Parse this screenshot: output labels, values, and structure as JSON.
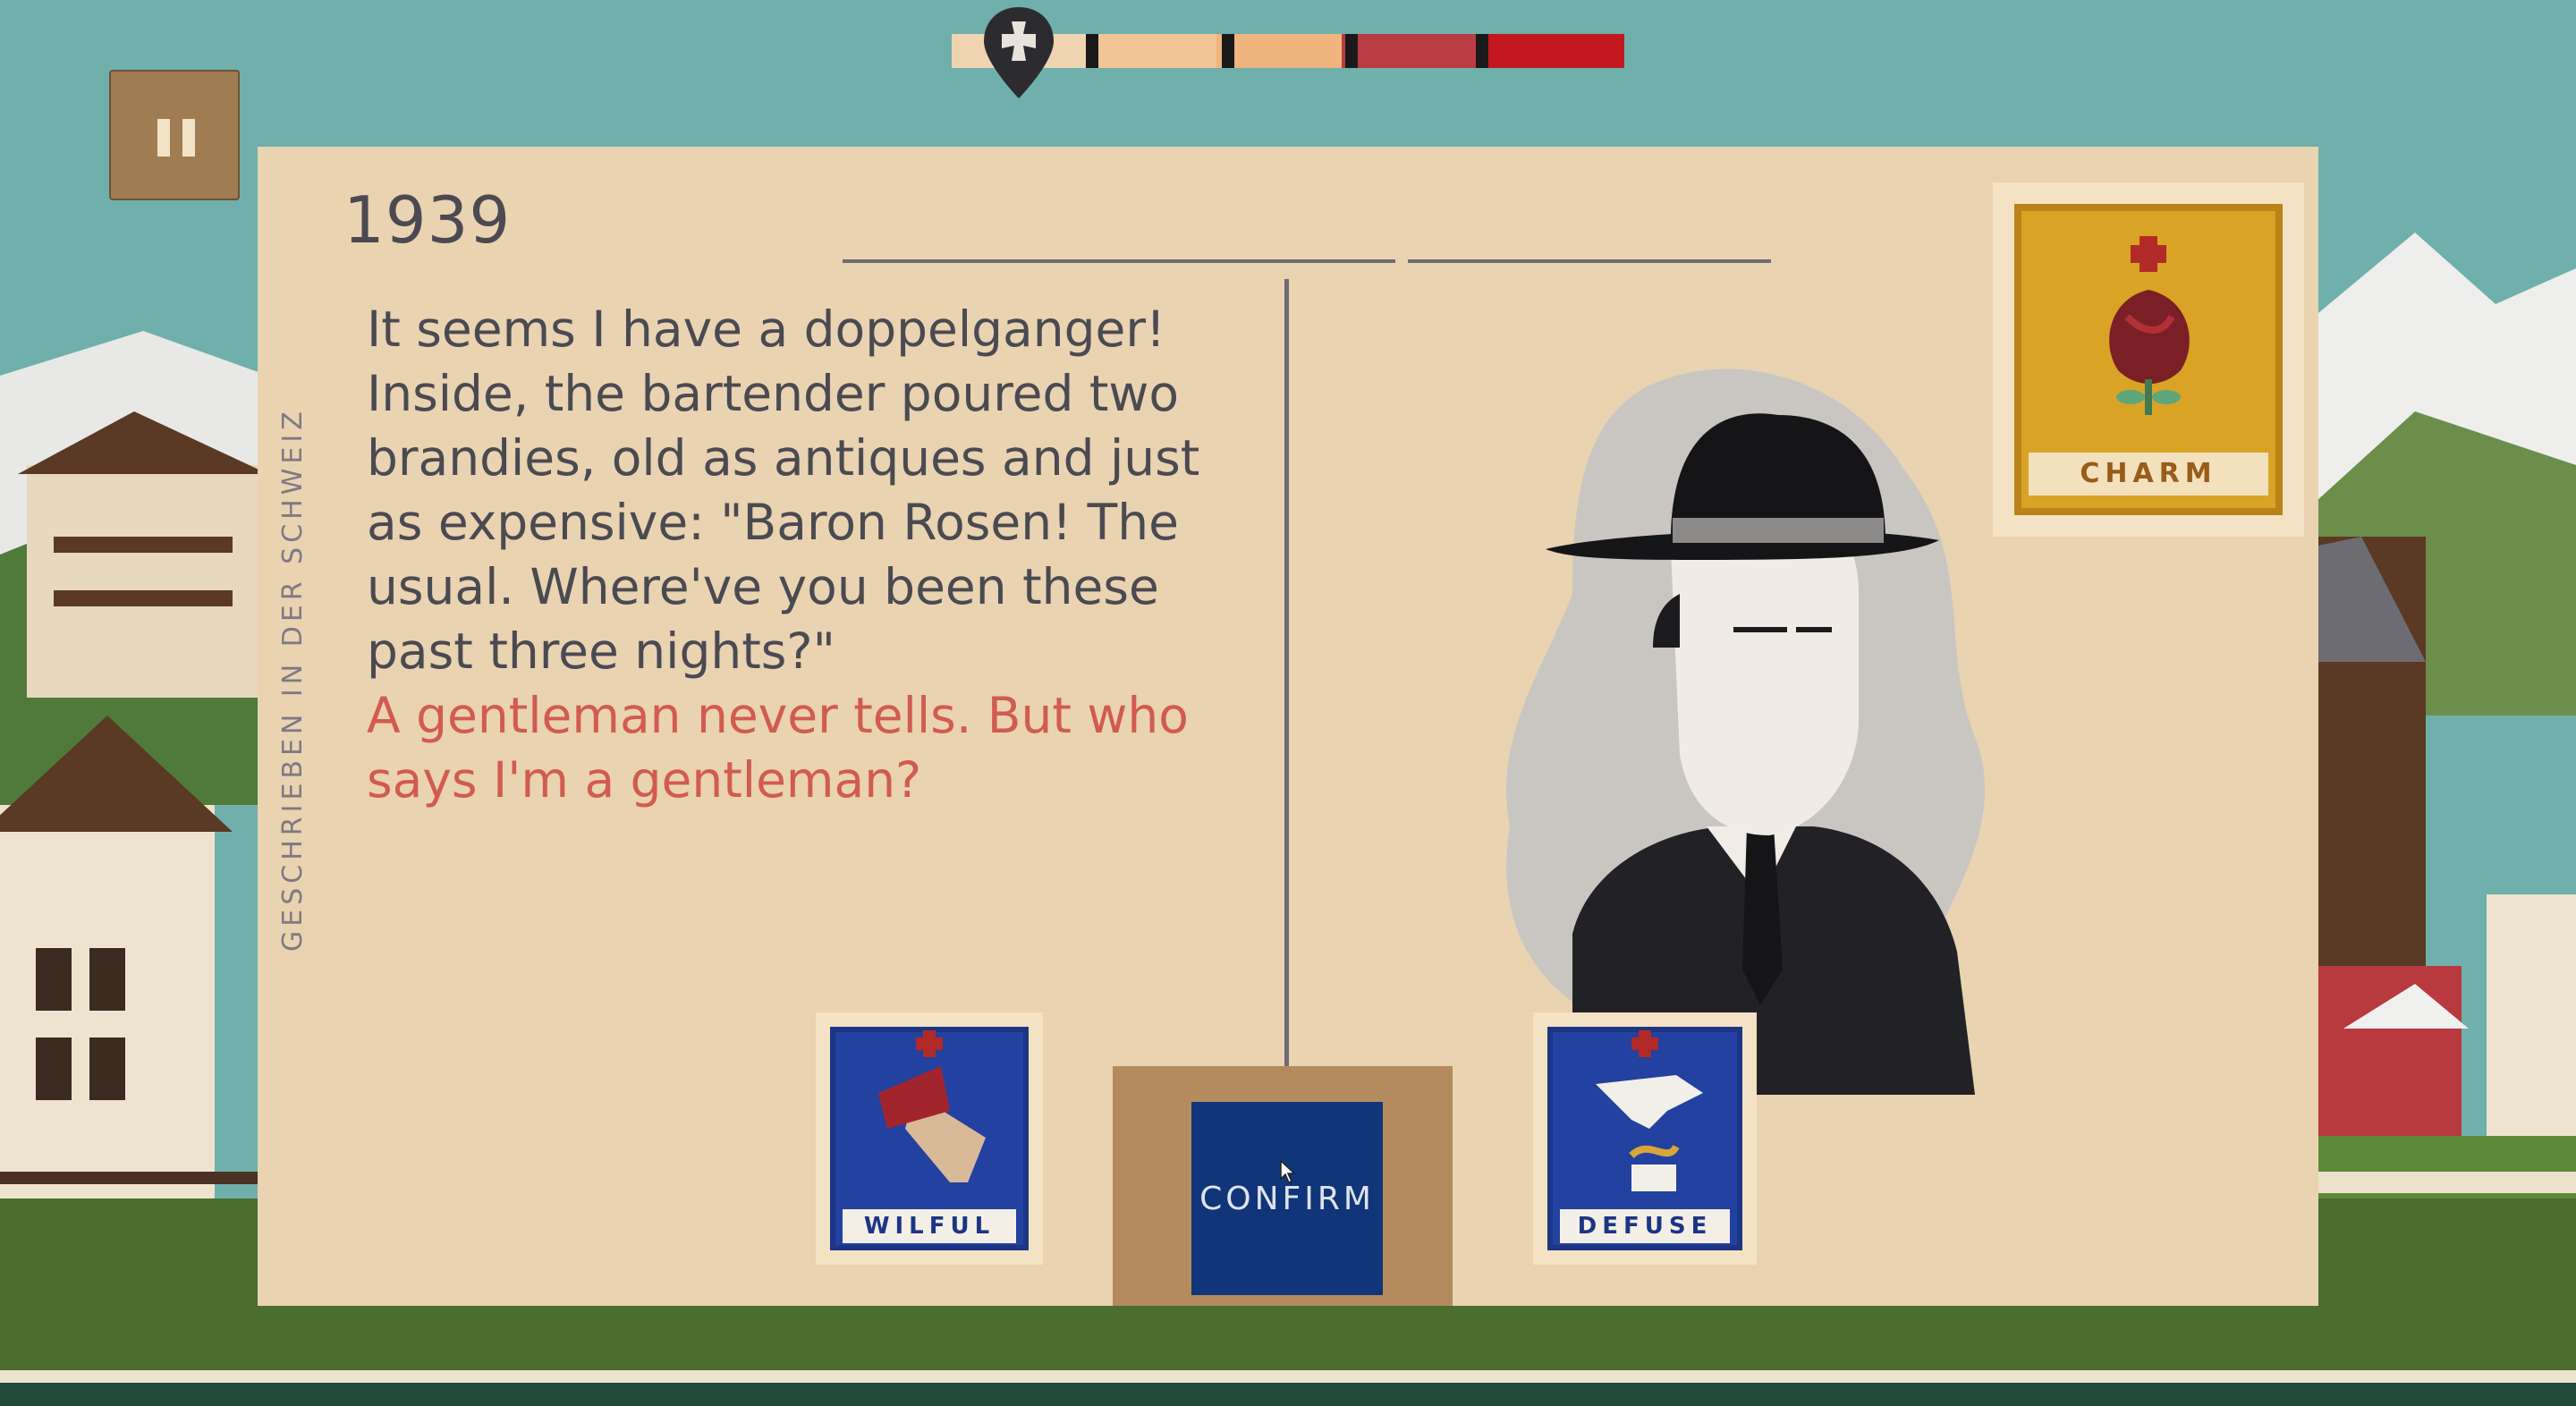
{
  "hud": {
    "pause_icon": "pause-icon",
    "progress": {
      "marker_icon": "swiss-cross-map-pin-icon",
      "segments": [
        "#efd4b1",
        "#f1c596",
        "#f0b47e",
        "#bb3b42",
        "#c3181f"
      ]
    }
  },
  "card": {
    "year": "1939",
    "side_caption": "GESCHRIEBEN IN DER SCHWEIZ",
    "story_lines": [
      "It seems I have a doppelganger!",
      "Inside, the bartender poured two",
      "brandies, old as antiques and just",
      "as expensive: \"Baron Rosen! The",
      "usual. Where've you been these",
      "past three nights?\""
    ],
    "choice_lines": [
      "A gentleman never tells. But who",
      "says I'm a gentleman?"
    ]
  },
  "stamps": {
    "charm": {
      "label": "CHARM",
      "icon": "rose-icon"
    },
    "wilful": {
      "label": "WILFUL",
      "icon": "axe-icon"
    },
    "defuse": {
      "label": "DEFUSE",
      "icon": "hand-dropping-icon"
    }
  },
  "confirm": {
    "label": "CONFIRM"
  },
  "colors": {
    "card": "#e9d3b1",
    "text": "#4a4a52",
    "choice_text": "#d25b50",
    "confirm": "#103579",
    "charm_gold": "#d9a325",
    "stamp_blue": "#2341a0"
  }
}
